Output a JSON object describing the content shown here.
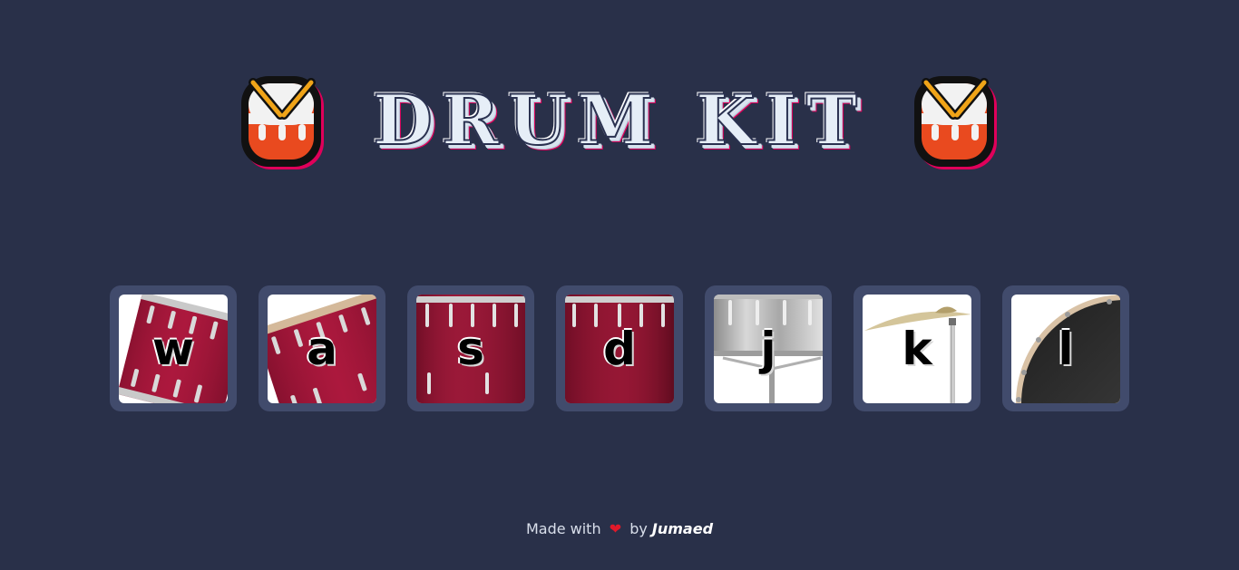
{
  "title": "DRUM KIT",
  "keys": [
    {
      "letter": "w",
      "instrument": "tom-1"
    },
    {
      "letter": "a",
      "instrument": "tom-2"
    },
    {
      "letter": "s",
      "instrument": "tom-3"
    },
    {
      "letter": "d",
      "instrument": "tom-4"
    },
    {
      "letter": "j",
      "instrument": "snare"
    },
    {
      "letter": "k",
      "instrument": "crash-cymbal"
    },
    {
      "letter": "l",
      "instrument": "kick-bass"
    }
  ],
  "footer": {
    "made_with": "Made with",
    "heart": "❤",
    "by": "by",
    "author": "Jumaed"
  },
  "colors": {
    "background": "#293049",
    "key_frame": "#414b6c",
    "title_fill": "#e6eef7",
    "title_accent": "#e0005a",
    "tom_red": "#a3163a",
    "heart": "#e0192a"
  },
  "icons": {
    "title_left": "drum-with-sticks-icon",
    "title_right": "drum-with-sticks-icon"
  }
}
